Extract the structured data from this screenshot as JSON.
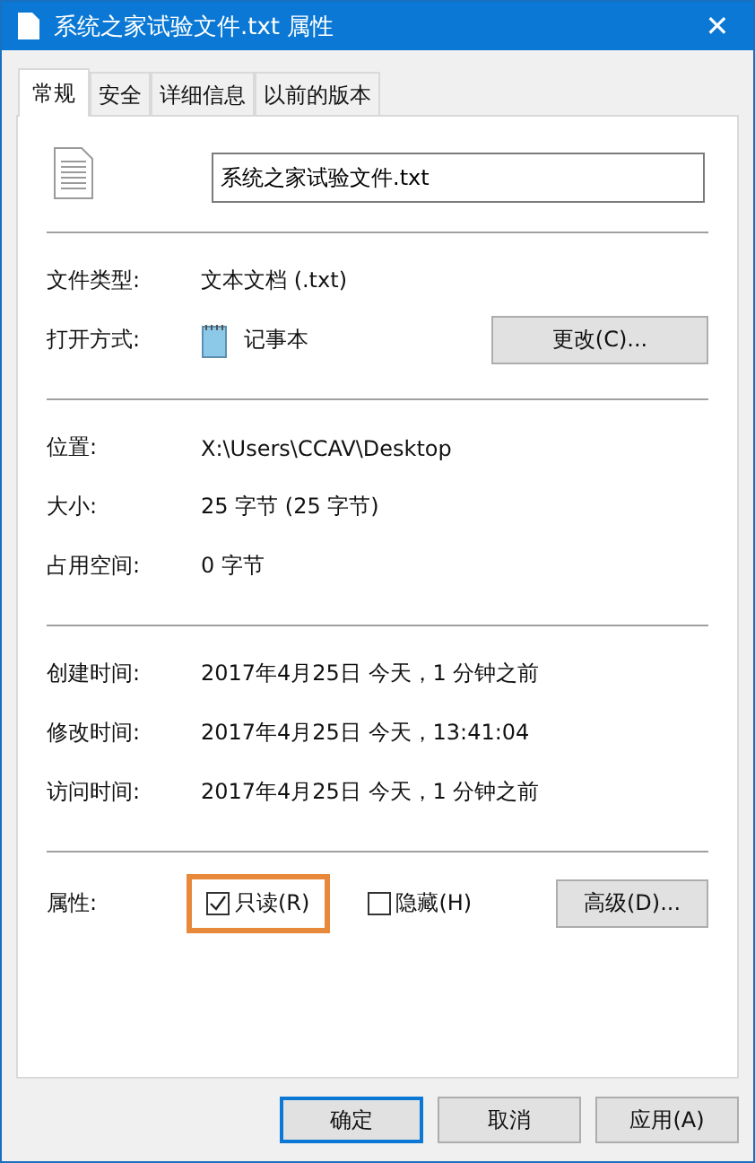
{
  "window": {
    "title": "系统之家试验文件.txt 属性",
    "close": "✕"
  },
  "tabs": [
    {
      "label": "常规",
      "selected": true
    },
    {
      "label": "安全",
      "selected": false
    },
    {
      "label": "详细信息",
      "selected": false
    },
    {
      "label": "以前的版本",
      "selected": false
    }
  ],
  "file_name": "系统之家试验文件.txt",
  "type_section": [
    {
      "label": "文件类型:",
      "value": "文本文档 (.txt)"
    },
    {
      "label": "打开方式:",
      "value": "记事本",
      "button": "更改(C)..."
    }
  ],
  "size_section": [
    {
      "label": "位置:",
      "value": "X:\\Users\\CCAV\\Desktop"
    },
    {
      "label": "大小:",
      "value": "25 字节 (25 字节)"
    },
    {
      "label": "占用空间:",
      "value": "0 字节"
    }
  ],
  "time_section": [
    {
      "label": "创建时间:",
      "value": "2017年4月25日 今天，1 分钟之前"
    },
    {
      "label": "修改时间:",
      "value": "2017年4月25日 今天，13:41:04"
    },
    {
      "label": "访问时间:",
      "value": "2017年4月25日 今天，1 分钟之前"
    }
  ],
  "attributes": {
    "label": "属性:",
    "options": [
      {
        "label": "只读(R)",
        "checked": true,
        "highlighted": true
      },
      {
        "label": "隐藏(H)",
        "checked": false,
        "highlighted": false
      }
    ],
    "button": "高级(D)..."
  },
  "buttons": [
    {
      "label": "确定",
      "selected": true
    },
    {
      "label": "取消",
      "selected": false
    },
    {
      "label": "应用(A)",
      "selected": false
    }
  ]
}
